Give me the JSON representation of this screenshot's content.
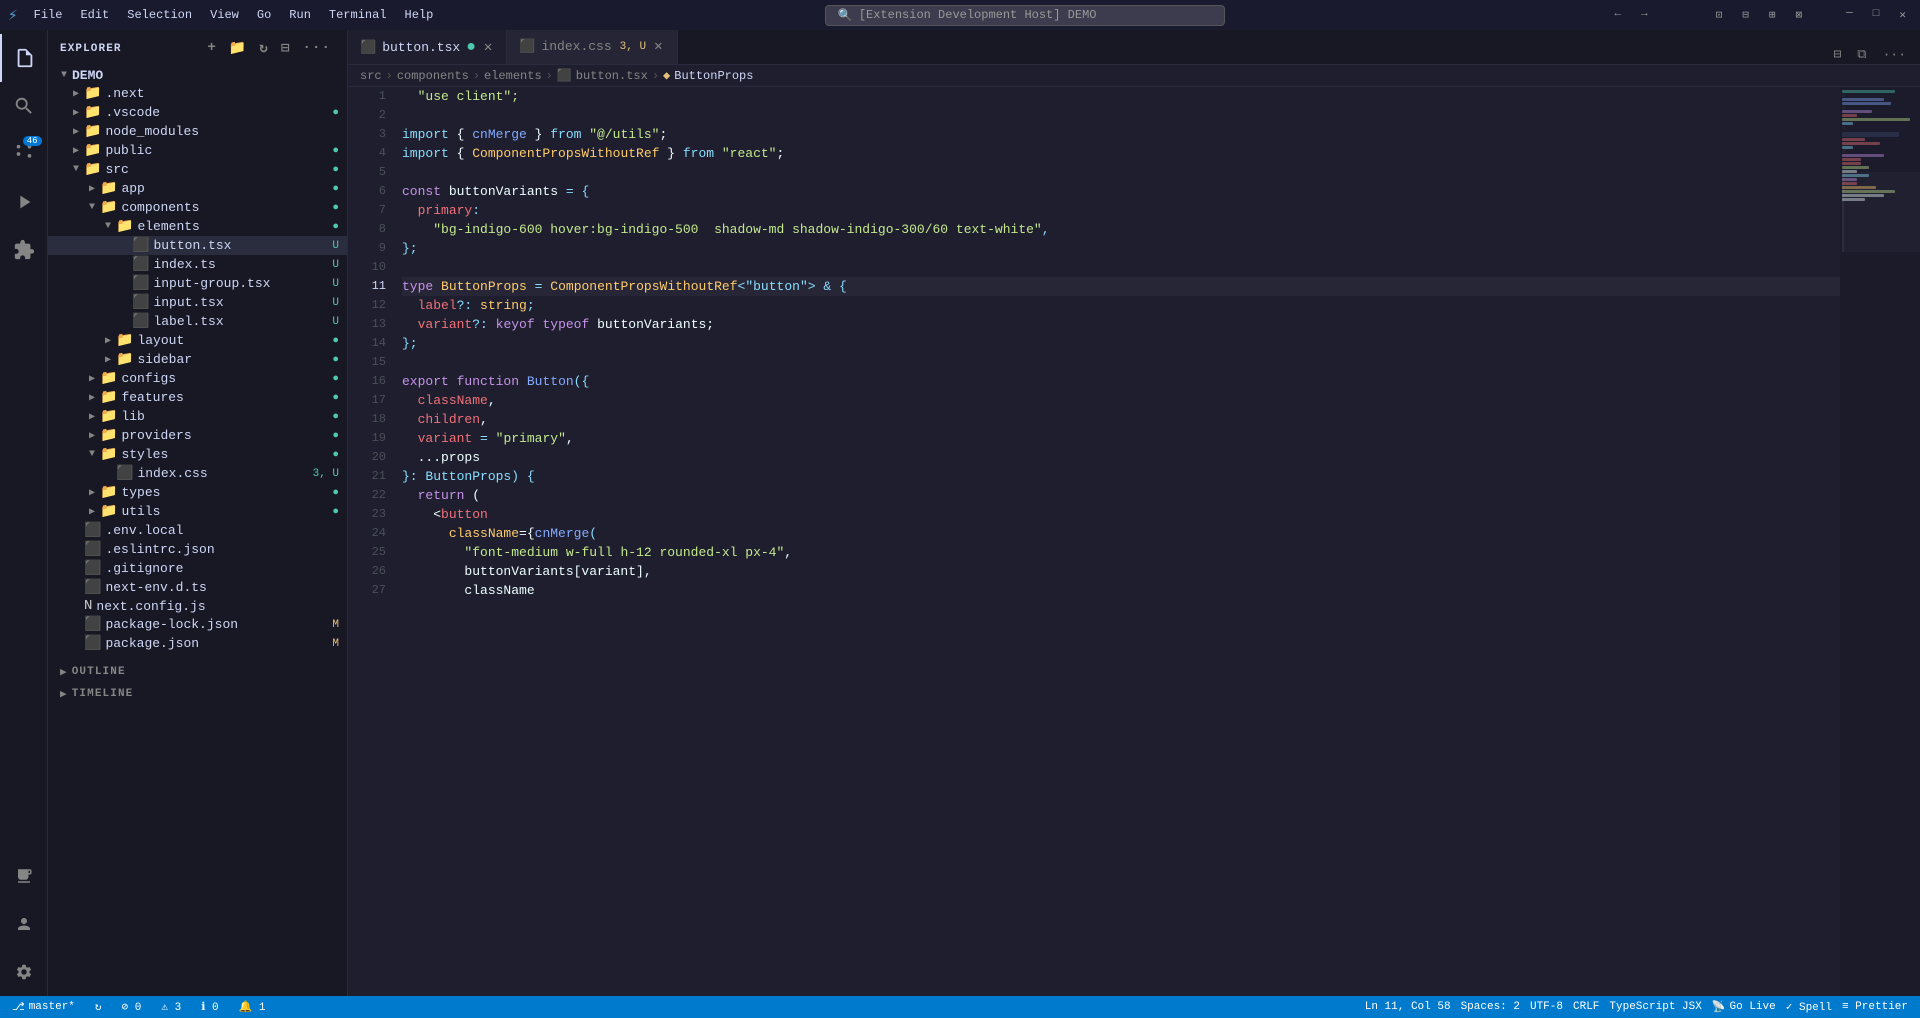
{
  "titlebar": {
    "icon": "⚡",
    "menu": [
      "File",
      "Edit",
      "Selection",
      "View",
      "Go",
      "Run",
      "Terminal",
      "Help"
    ],
    "search_placeholder": "[Extension Development Host] DEMO",
    "nav_back": "←",
    "nav_forward": "→"
  },
  "activity_bar": {
    "icons": [
      {
        "name": "explorer-icon",
        "symbol": "📄",
        "active": true
      },
      {
        "name": "search-icon",
        "symbol": "🔍",
        "active": false
      },
      {
        "name": "source-control-icon",
        "symbol": "⎇",
        "active": false,
        "badge": "46"
      },
      {
        "name": "run-debug-icon",
        "symbol": "▶",
        "active": false
      },
      {
        "name": "extensions-icon",
        "symbol": "⊞",
        "active": false
      },
      {
        "name": "remote-icon",
        "symbol": "🖥",
        "active": false,
        "bottom": true
      },
      {
        "name": "accounts-icon",
        "symbol": "👤",
        "bottom": true
      },
      {
        "name": "settings-icon",
        "symbol": "⚙",
        "bottom": true
      }
    ]
  },
  "sidebar": {
    "title": "EXPLORER",
    "root": "DEMO",
    "tree": [
      {
        "id": "next",
        "label": ".next",
        "type": "folder",
        "indent": 1,
        "collapsed": true
      },
      {
        "id": "vscode",
        "label": ".vscode",
        "type": "folder",
        "indent": 1,
        "collapsed": true,
        "badge": "●",
        "badge_type": "green"
      },
      {
        "id": "node_modules",
        "label": "node_modules",
        "type": "folder",
        "indent": 1,
        "collapsed": true
      },
      {
        "id": "public",
        "label": "public",
        "type": "folder",
        "indent": 1,
        "collapsed": true,
        "badge": "●",
        "badge_type": "green"
      },
      {
        "id": "src",
        "label": "src",
        "type": "folder-src",
        "indent": 1,
        "collapsed": false,
        "badge": "●",
        "badge_type": "green"
      },
      {
        "id": "app",
        "label": "app",
        "type": "folder",
        "indent": 2,
        "collapsed": true,
        "badge": "●",
        "badge_type": "green"
      },
      {
        "id": "components",
        "label": "components",
        "type": "folder-components",
        "indent": 2,
        "collapsed": false,
        "badge": "●",
        "badge_type": "green"
      },
      {
        "id": "elements",
        "label": "elements",
        "type": "folder-elements",
        "indent": 3,
        "collapsed": false,
        "badge": "●",
        "badge_type": "green"
      },
      {
        "id": "button.tsx",
        "label": "button.tsx",
        "type": "tsx",
        "indent": 4,
        "selected": true,
        "badge": "U",
        "badge_type": "u"
      },
      {
        "id": "index.ts",
        "label": "index.ts",
        "type": "ts",
        "indent": 4,
        "badge": "U",
        "badge_type": "u"
      },
      {
        "id": "input-group.tsx",
        "label": "input-group.tsx",
        "type": "tsx",
        "indent": 4,
        "badge": "U",
        "badge_type": "u"
      },
      {
        "id": "input.tsx",
        "label": "input.tsx",
        "type": "tsx",
        "indent": 4,
        "badge": "U",
        "badge_type": "u"
      },
      {
        "id": "label.tsx",
        "label": "label.tsx",
        "type": "tsx",
        "indent": 4,
        "badge": "U",
        "badge_type": "u"
      },
      {
        "id": "layout",
        "label": "layout",
        "type": "folder",
        "indent": 3,
        "collapsed": true,
        "badge": "●",
        "badge_type": "green"
      },
      {
        "id": "sidebar",
        "label": "sidebar",
        "type": "folder",
        "indent": 3,
        "collapsed": true,
        "badge": "●",
        "badge_type": "green"
      },
      {
        "id": "configs",
        "label": "configs",
        "type": "folder",
        "indent": 2,
        "collapsed": true,
        "badge": "●",
        "badge_type": "green"
      },
      {
        "id": "features",
        "label": "features",
        "type": "folder",
        "indent": 2,
        "collapsed": true,
        "badge": "●",
        "badge_type": "green"
      },
      {
        "id": "lib",
        "label": "lib",
        "type": "folder",
        "indent": 2,
        "collapsed": true,
        "badge": "●",
        "badge_type": "green"
      },
      {
        "id": "providers",
        "label": "providers",
        "type": "folder",
        "indent": 2,
        "collapsed": true,
        "badge": "●",
        "badge_type": "green"
      },
      {
        "id": "styles",
        "label": "styles",
        "type": "folder",
        "indent": 2,
        "collapsed": false,
        "badge": "●",
        "badge_type": "green"
      },
      {
        "id": "index.css",
        "label": "index.css",
        "type": "css",
        "indent": 3,
        "badge": "3, U",
        "badge_type": "u"
      },
      {
        "id": "types",
        "label": "types",
        "type": "folder",
        "indent": 2,
        "collapsed": true,
        "badge": "●",
        "badge_type": "green"
      },
      {
        "id": "utils",
        "label": "utils",
        "type": "folder",
        "indent": 2,
        "collapsed": true,
        "badge": "●",
        "badge_type": "green"
      },
      {
        "id": ".env.local",
        "label": ".env.local",
        "type": "env",
        "indent": 1
      },
      {
        "id": ".eslintrc.json",
        "label": ".eslintrc.json",
        "type": "eslint",
        "indent": 1
      },
      {
        "id": ".gitignore",
        "label": ".gitignore",
        "type": "git",
        "indent": 1
      },
      {
        "id": "next-env.d.ts",
        "label": "next-env.d.ts",
        "type": "ts",
        "indent": 1
      },
      {
        "id": "next.config.js",
        "label": "next.config.js",
        "type": "next",
        "indent": 1
      },
      {
        "id": "package-lock.json",
        "label": "package-lock.json",
        "type": "json",
        "indent": 1,
        "badge": "M",
        "badge_type": "m"
      },
      {
        "id": "package.json",
        "label": "package.json",
        "type": "json",
        "indent": 1,
        "badge": "M",
        "badge_type": "m"
      }
    ],
    "sections": [
      {
        "id": "outline",
        "label": "OUTLINE"
      },
      {
        "id": "timeline",
        "label": "TIMELINE"
      }
    ]
  },
  "tabs": [
    {
      "id": "button.tsx",
      "label": "button.tsx",
      "icon": "tsx",
      "active": true,
      "modified": true,
      "unsaved": true
    },
    {
      "id": "index.css",
      "label": "index.css",
      "icon": "css",
      "active": false,
      "badge": "3, U",
      "modified": true
    }
  ],
  "breadcrumb": {
    "items": [
      "src",
      "components",
      "elements",
      "button.tsx",
      "ButtonProps"
    ]
  },
  "editor": {
    "lines": [
      {
        "num": 1,
        "tokens": [
          {
            "text": "  \"use client\";",
            "class": "str"
          }
        ]
      },
      {
        "num": 2,
        "tokens": []
      },
      {
        "num": 3,
        "tokens": [
          {
            "text": "import",
            "class": "kw2"
          },
          {
            "text": " { ",
            "class": "var"
          },
          {
            "text": "cnMerge",
            "class": "fn"
          },
          {
            "text": " } ",
            "class": "var"
          },
          {
            "text": "from",
            "class": "kw2"
          },
          {
            "text": " \"@/utils\";",
            "class": "str"
          }
        ]
      },
      {
        "num": 4,
        "tokens": [
          {
            "text": "import",
            "class": "kw2"
          },
          {
            "text": " { ",
            "class": "var"
          },
          {
            "text": "ComponentPropsWithoutRef",
            "class": "type"
          },
          {
            "text": " } ",
            "class": "var"
          },
          {
            "text": "from",
            "class": "kw2"
          },
          {
            "text": " \"react\";",
            "class": "str"
          }
        ]
      },
      {
        "num": 5,
        "tokens": []
      },
      {
        "num": 6,
        "tokens": [
          {
            "text": "const",
            "class": "kw"
          },
          {
            "text": " buttonVariants ",
            "class": "var"
          },
          {
            "text": "=",
            "class": "op"
          },
          {
            "text": " {",
            "class": "punct"
          }
        ]
      },
      {
        "num": 7,
        "tokens": [
          {
            "text": "  primary",
            "class": "prop"
          },
          {
            "text": ":",
            "class": "punct"
          }
        ]
      },
      {
        "num": 8,
        "tokens": [
          {
            "text": "    \"bg-indigo-600 hover:bg-indigo-500  shadow-md shadow-indigo-300/60 text-white\",",
            "class": "str"
          }
        ]
      },
      {
        "num": 9,
        "tokens": [
          {
            "text": "};",
            "class": "punct"
          }
        ]
      },
      {
        "num": 10,
        "tokens": []
      },
      {
        "num": 11,
        "tokens": [
          {
            "text": "type",
            "class": "kw"
          },
          {
            "text": " ButtonProps ",
            "class": "type"
          },
          {
            "text": "=",
            "class": "op"
          },
          {
            "text": " ComponentPropsWithoutRef",
            "class": "type"
          },
          {
            "text": "<\"button\"> & {",
            "class": "punct"
          }
        ],
        "active": true
      },
      {
        "num": 12,
        "tokens": [
          {
            "text": "  label",
            "class": "prop"
          },
          {
            "text": "?:",
            "class": "op"
          },
          {
            "text": " string;",
            "class": "type"
          }
        ]
      },
      {
        "num": 13,
        "tokens": [
          {
            "text": "  variant",
            "class": "prop"
          },
          {
            "text": "?:",
            "class": "op"
          },
          {
            "text": " keyof",
            "class": "kw"
          },
          {
            "text": " typeof",
            "class": "kw"
          },
          {
            "text": " buttonVariants;",
            "class": "var"
          }
        ]
      },
      {
        "num": 14,
        "tokens": [
          {
            "text": "};",
            "class": "punct"
          }
        ]
      },
      {
        "num": 15,
        "tokens": []
      },
      {
        "num": 16,
        "tokens": [
          {
            "text": "export",
            "class": "kw"
          },
          {
            "text": " function",
            "class": "kw"
          },
          {
            "text": " Button",
            "class": "fn"
          },
          {
            "text": "({",
            "class": "punct"
          }
        ]
      },
      {
        "num": 17,
        "tokens": [
          {
            "text": "  className,",
            "class": "prop"
          }
        ]
      },
      {
        "num": 18,
        "tokens": [
          {
            "text": "  children,",
            "class": "prop"
          }
        ]
      },
      {
        "num": 19,
        "tokens": [
          {
            "text": "  variant",
            "class": "prop"
          },
          {
            "text": " = ",
            "class": "op"
          },
          {
            "text": "\"primary\",",
            "class": "str"
          }
        ]
      },
      {
        "num": 20,
        "tokens": [
          {
            "text": "  ...props",
            "class": "var"
          }
        ]
      },
      {
        "num": 21,
        "tokens": [
          {
            "text": "}: ButtonProps) {",
            "class": "punct"
          }
        ]
      },
      {
        "num": 22,
        "tokens": [
          {
            "text": "  return (",
            "class": "kw"
          }
        ]
      },
      {
        "num": 23,
        "tokens": [
          {
            "text": "    <",
            "class": "punct"
          },
          {
            "text": "button",
            "class": "tag"
          }
        ]
      },
      {
        "num": 24,
        "tokens": [
          {
            "text": "      className={",
            "class": "attr"
          },
          {
            "text": "cnMerge",
            "class": "fn"
          },
          {
            "text": "(",
            "class": "punct"
          }
        ]
      },
      {
        "num": 25,
        "tokens": [
          {
            "text": "        \"font-medium w-full h-12 rounded-xl px-4\",",
            "class": "str"
          }
        ]
      },
      {
        "num": 26,
        "tokens": [
          {
            "text": "        buttonVariants[variant],",
            "class": "var"
          }
        ]
      },
      {
        "num": 27,
        "tokens": [
          {
            "text": "        className",
            "class": "var"
          }
        ]
      }
    ]
  },
  "status_bar": {
    "branch": "master*",
    "sync": "↻",
    "errors": "⊘ 0",
    "warnings": "⚠ 3",
    "info": "ℹ 0",
    "bell": "🔔 1",
    "position": "Ln 11, Col 58",
    "spaces": "Spaces: 2",
    "encoding": "UTF-8",
    "line_ending": "CRLF",
    "language": "TypeScript JSX",
    "go_live": "Go Live",
    "spell": "✓ Spell",
    "prettier": "≡ Prettier"
  }
}
